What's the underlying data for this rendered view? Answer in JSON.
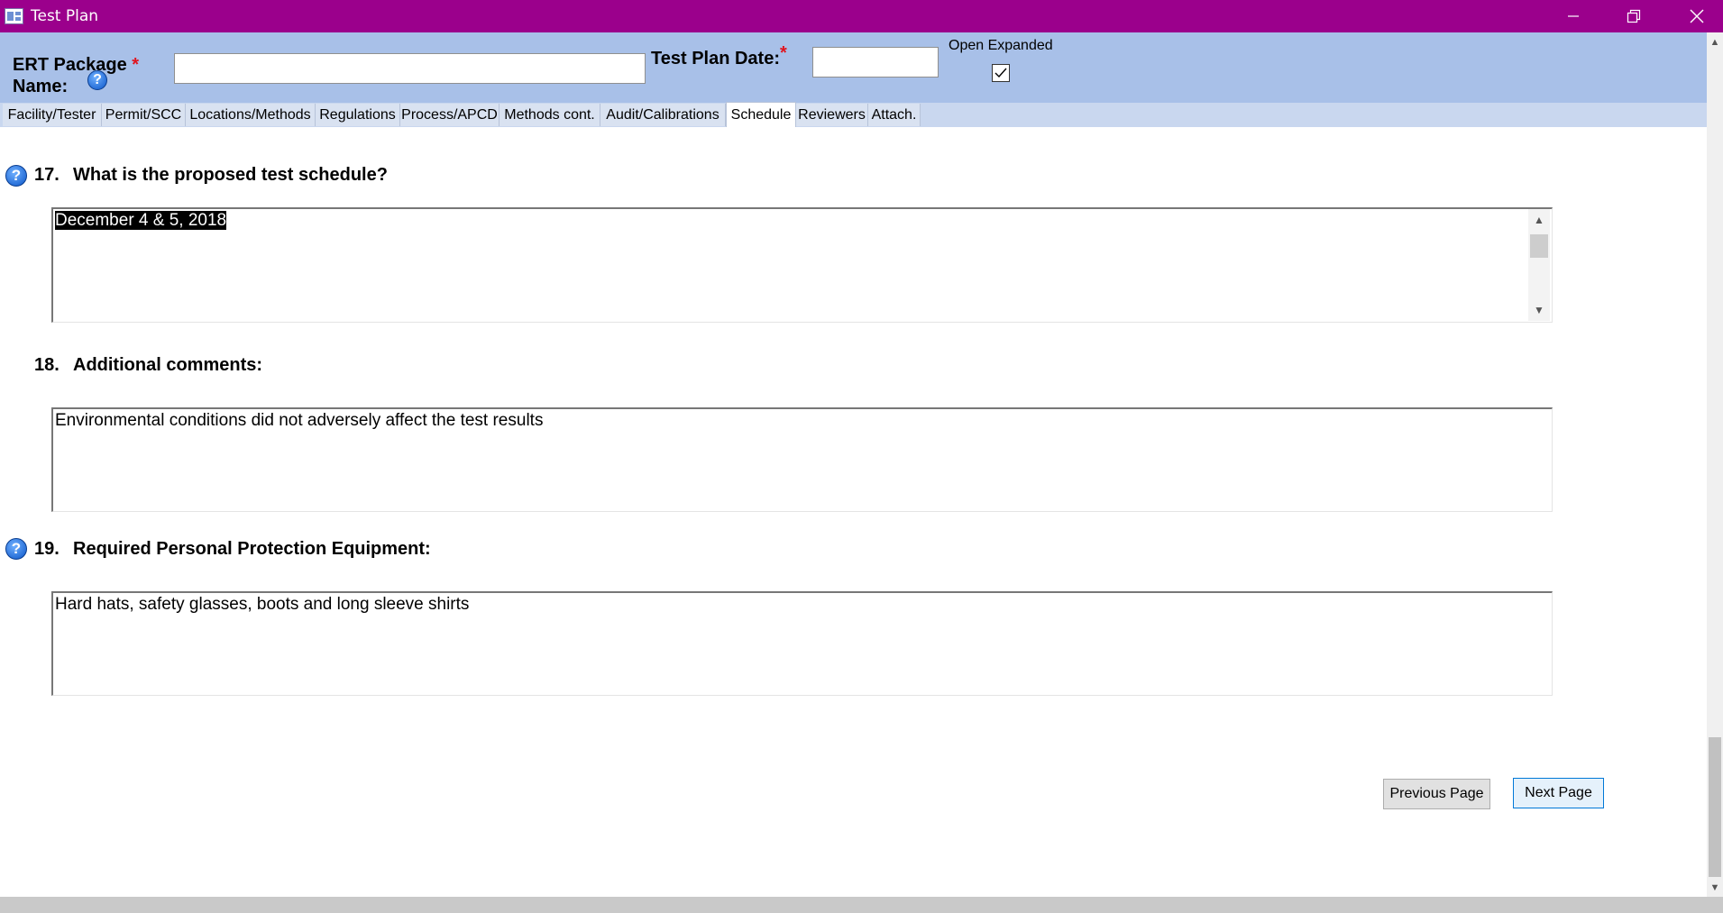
{
  "window": {
    "title": "Test Plan",
    "minimize_icon": "minimize-icon",
    "restore_icon": "restore-icon",
    "close_icon": "close-icon"
  },
  "header": {
    "package_label": "ERT Package",
    "package_label_line2": "Name:",
    "required_mark": "*",
    "package_value": "",
    "date_label": "Test Plan Date:",
    "date_value": "",
    "open_expanded_label": "Open Expanded",
    "open_expanded_checked": true
  },
  "tabs": [
    {
      "label": "Facility/Tester",
      "active": false
    },
    {
      "label": "Permit/SCC",
      "active": false
    },
    {
      "label": "Locations/Methods",
      "active": false
    },
    {
      "label": "Regulations",
      "active": false
    },
    {
      "label": "Process/APCD",
      "active": false
    },
    {
      "label": "Methods cont.",
      "active": false
    },
    {
      "label": "Audit/Calibrations",
      "active": false
    },
    {
      "label": "Schedule",
      "active": true
    },
    {
      "label": "Reviewers",
      "active": false
    },
    {
      "label": "Attach.",
      "active": false
    }
  ],
  "questions": [
    {
      "number": "17.",
      "text": "What is the proposed test schedule?",
      "answer": "December 4 & 5, 2018",
      "has_help": true
    },
    {
      "number": "18.",
      "text": "Additional comments:",
      "answer": "Environmental conditions did not adversely affect the test results",
      "has_help": false
    },
    {
      "number": "19.",
      "text": "Required Personal Protection Equipment:",
      "answer": "Hard hats, safety glasses, boots and long sleeve shirts",
      "has_help": true
    }
  ],
  "help_glyph": "?",
  "nav": {
    "previous_label": "Previous Page",
    "next_label": "Next Page"
  },
  "colors": {
    "titlebar": "#9b008c",
    "header_bg": "#a8c0e8",
    "required": "#e0141e"
  }
}
